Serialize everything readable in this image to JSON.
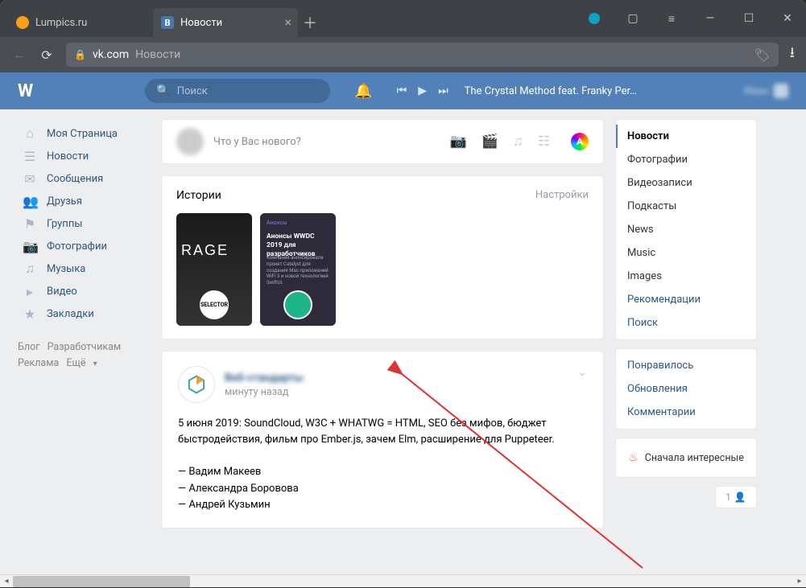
{
  "browser": {
    "tabs": [
      {
        "title": "Lumpics.ru",
        "active": false,
        "favicon_color": "#f7a11b"
      },
      {
        "title": "Новости",
        "active": true,
        "favicon_letter": "B",
        "favicon_bg": "#4a76a8"
      }
    ],
    "back_disabled": true,
    "address_domain": "vk.com",
    "address_page": "Новости"
  },
  "vk_header": {
    "logo": "W",
    "search_placeholder": "Поиск",
    "track": "The Crystal Method feat. Franky Per…"
  },
  "left_nav": {
    "items": [
      {
        "icon": "⌂",
        "label": "Моя Страница"
      },
      {
        "icon": "☰",
        "label": "Новости"
      },
      {
        "icon": "✉",
        "label": "Сообщения"
      },
      {
        "icon": "👥",
        "label": "Друзья"
      },
      {
        "icon": "⚑",
        "label": "Группы"
      },
      {
        "icon": "📷",
        "label": "Фотографии"
      },
      {
        "icon": "♫",
        "label": "Музыка"
      },
      {
        "icon": "▸",
        "label": "Видео"
      },
      {
        "icon": "★",
        "label": "Закладки"
      }
    ],
    "footer": {
      "blog": "Блог",
      "dev": "Разработчикам",
      "ads": "Реклама",
      "more": "Ещё"
    }
  },
  "composer": {
    "placeholder": "Что у Вас нового?",
    "rainbow_letter": "A"
  },
  "stories": {
    "title": "Истории",
    "settings": "Настройки",
    "story1_title": "RAGE",
    "story2_tag": "Анонсы",
    "story2_title": "Анонсы WWDC 2019 для разработчиков",
    "story2_text": "Компания анонсировала проект Catalyst для создания Mac-приложений WiFi 3 и новой технологией SwiftUI."
  },
  "post": {
    "author_hidden": "Веб-стандарты",
    "time": "минуту назад",
    "body": "5 июня 2019: SoundCloud, W3C + WHATWG = HTML, SEO без мифов, бюджет быстродействия, фильм про Ember.js, зачем Elm, расширение для Puppeteer.",
    "lines": [
      "— Вадим Макеев",
      "— Александра Боровова",
      "— Андрей Кузьмин"
    ]
  },
  "right": {
    "tabs1": [
      {
        "label": "Новости",
        "active": true
      },
      {
        "label": "Фотографии"
      },
      {
        "label": "Видеозаписи"
      },
      {
        "label": "Подкасты"
      },
      {
        "label": "News"
      },
      {
        "label": "Music"
      },
      {
        "label": "Images"
      },
      {
        "label": "Рекомендации",
        "link": true
      },
      {
        "label": "Поиск",
        "link": true
      }
    ],
    "tabs2": [
      {
        "label": "Понравилось"
      },
      {
        "label": "Обновления"
      },
      {
        "label": "Комментарии"
      }
    ],
    "interest": "Сначала интересные",
    "counter": "1"
  }
}
